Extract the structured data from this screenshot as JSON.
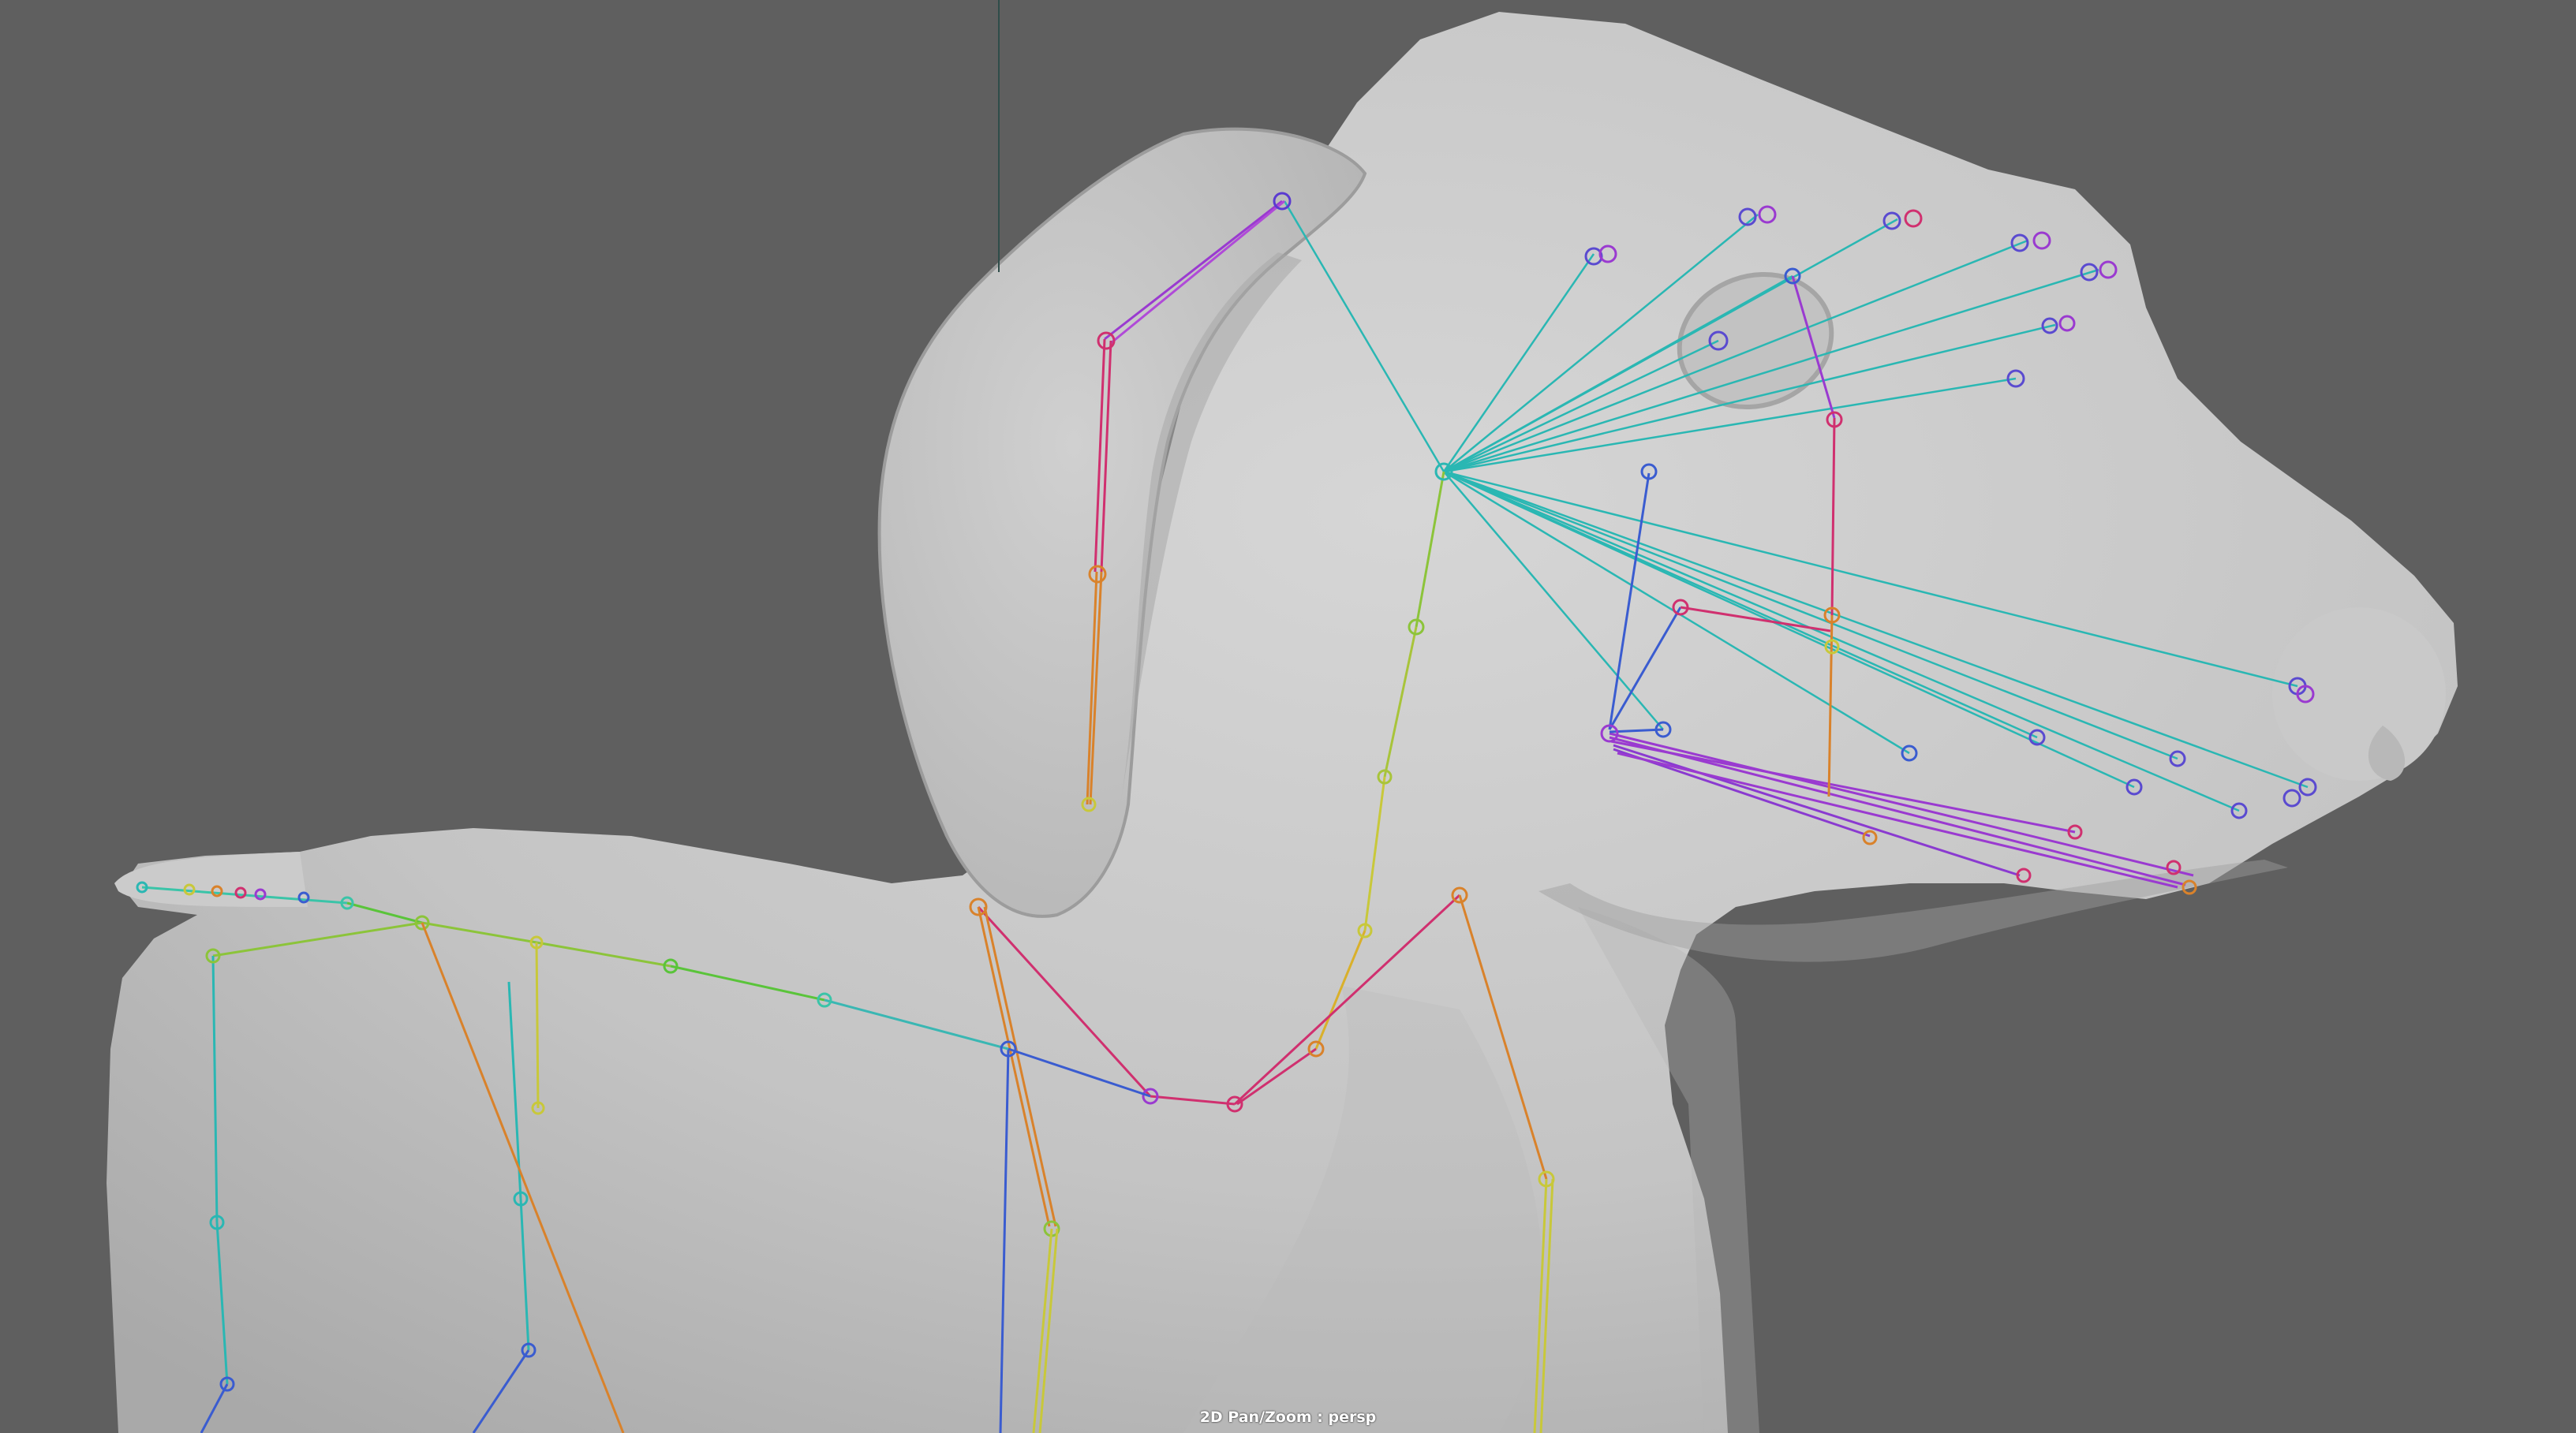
{
  "viewport": {
    "camera": "persp",
    "hud_label": "2D Pan/Zoom : persp"
  },
  "colors": {
    "background": "#5f5f5f",
    "mesh": "#c9c9c9",
    "joint_cyan": "#2ab7b3",
    "joint_purple": "#9a3ad0",
    "joint_magenta": "#d0306f",
    "joint_orange": "#d9822b",
    "joint_yellow": "#c8c83a",
    "joint_green": "#7ac43a",
    "joint_blue": "#3a5cd0"
  }
}
